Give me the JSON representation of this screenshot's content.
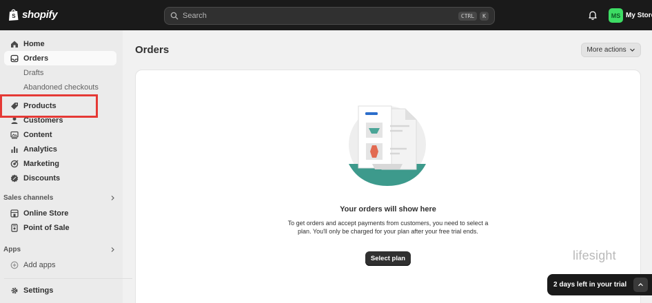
{
  "topbar": {
    "brand": "shopify",
    "search_placeholder": "Search",
    "shortcut_key1": "CTRL",
    "shortcut_key2": "K",
    "avatar_initials": "MS",
    "store_name": "My Store"
  },
  "sidebar": {
    "items": [
      {
        "label": "Home",
        "icon": "home-icon"
      },
      {
        "label": "Orders",
        "icon": "inbox-icon"
      },
      {
        "label": "Drafts"
      },
      {
        "label": "Abandoned checkouts"
      },
      {
        "label": "Products",
        "icon": "tag-icon"
      },
      {
        "label": "Customers",
        "icon": "person-icon"
      },
      {
        "label": "Content",
        "icon": "content-icon"
      },
      {
        "label": "Analytics",
        "icon": "bar-chart-icon"
      },
      {
        "label": "Marketing",
        "icon": "target-icon"
      },
      {
        "label": "Discounts",
        "icon": "discount-icon"
      }
    ],
    "sales_channels_label": "Sales channels",
    "channels": [
      {
        "label": "Online Store",
        "icon": "store-icon"
      },
      {
        "label": "Point of Sale",
        "icon": "pos-icon"
      }
    ],
    "apps_label": "Apps",
    "add_apps": "Add apps",
    "settings": "Settings"
  },
  "main": {
    "title": "Orders",
    "more_actions": "More actions",
    "empty_heading": "Your orders will show here",
    "empty_body": "To get orders and accept payments from customers, you need to select a plan. You'll only be charged for your plan after your free trial ends.",
    "select_plan": "Select plan"
  },
  "watermark": "lifesight",
  "trial_banner": "2 days left in your trial",
  "colors": {
    "topbar": "#1a1a1a",
    "sidebar": "#ebebeb",
    "avatar": "#3ddc64",
    "highlight": "#e53935",
    "illustration_teal": "#3d9a8c"
  }
}
